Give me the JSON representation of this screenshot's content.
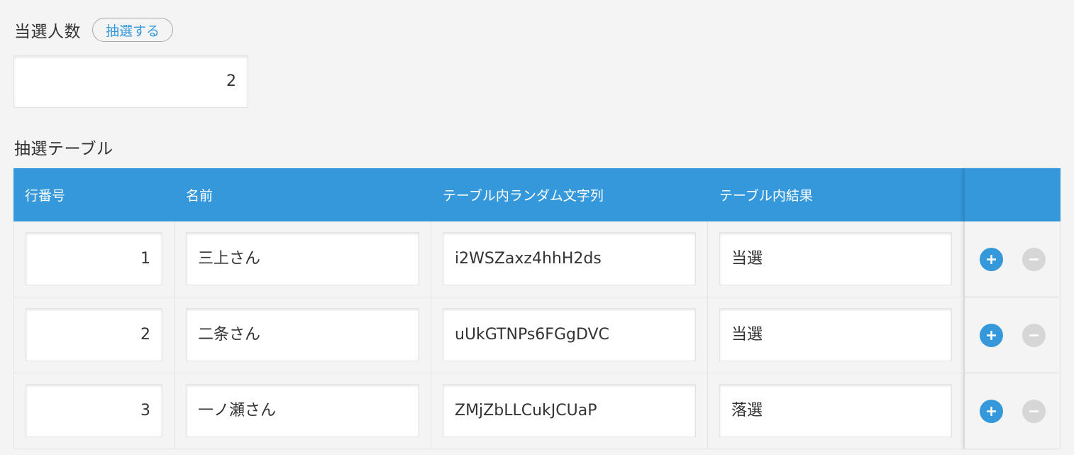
{
  "winners_field": {
    "label": "当選人数",
    "draw_button_label": "抽選する",
    "value": "2"
  },
  "table": {
    "title": "抽選テーブル",
    "columns": [
      "行番号",
      "名前",
      "テーブル内ランダム文字列",
      "テーブル内結果"
    ],
    "rows": [
      {
        "row_number": "1",
        "name": "三上さん",
        "random_string": "i2WSZaxz4hhH2ds",
        "result": "当選"
      },
      {
        "row_number": "2",
        "name": "二条さん",
        "random_string": "uUkGTNPs6FGgDVC",
        "result": "当選"
      },
      {
        "row_number": "3",
        "name": "一ノ瀬さん",
        "random_string": "ZMjZbLLCukJCUaP",
        "result": "落選"
      }
    ],
    "row_actions": {
      "add_icon": "plus-circle-icon",
      "remove_icon": "minus-circle-icon"
    }
  },
  "colors": {
    "accent": "#3498db",
    "background": "#f4f4f4",
    "disabled": "#d6d6d6"
  }
}
